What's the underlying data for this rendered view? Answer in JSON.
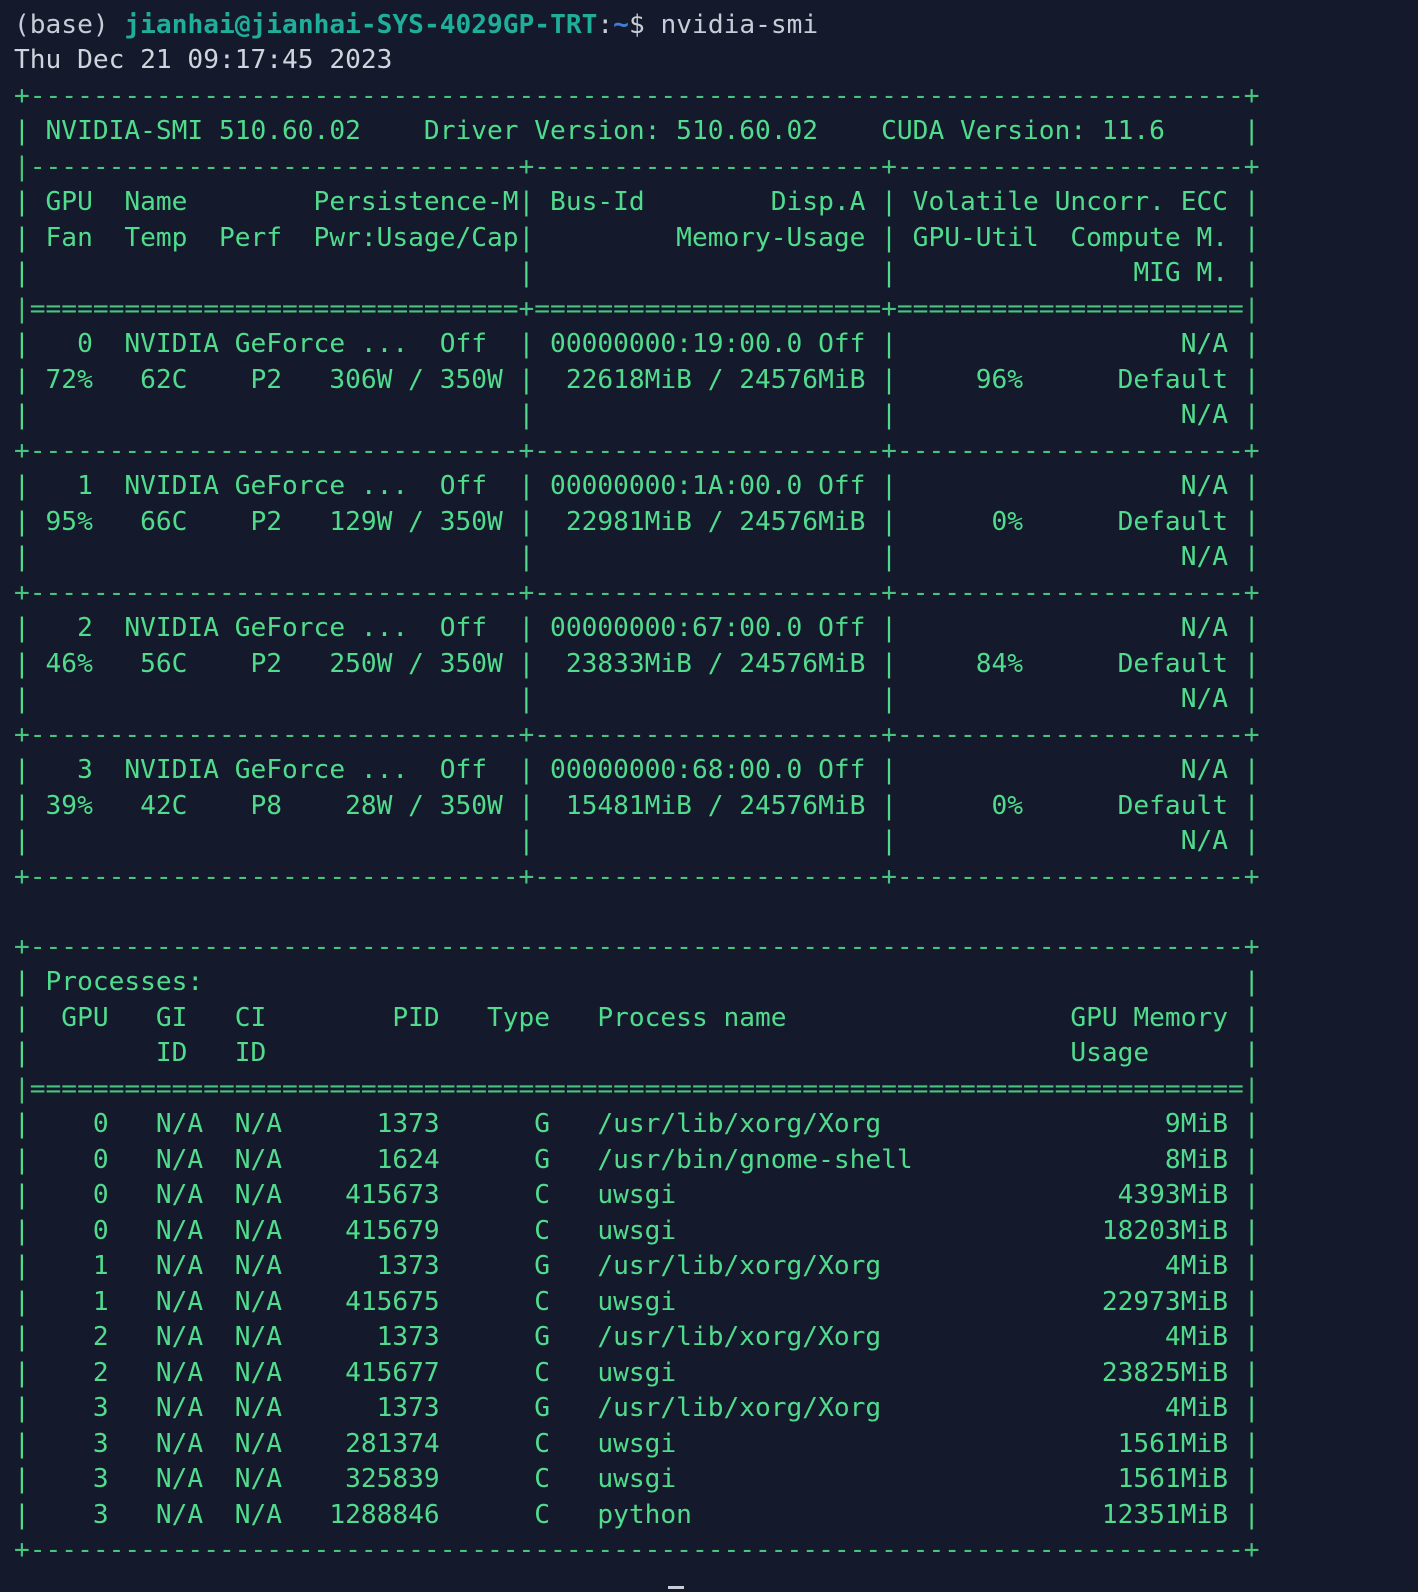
{
  "prompt": {
    "env": "(base)",
    "user_host": "jianhai@jianhai-SYS-4029GP-TRT",
    "colon": ":",
    "path": "~",
    "dollar": "$",
    "command": "nvidia-smi"
  },
  "timestamp": "Thu Dec 21 09:17:45 2023",
  "gpu_table": {
    "border_top": "+-----------------------------------------------------------------------------+",
    "version_line": "| NVIDIA-SMI 510.60.02    Driver Version: 510.60.02    CUDA Version: 11.6     |",
    "header_separator": "|-------------------------------+----------------------+----------------------+",
    "header_row_1": "| GPU  Name        Persistence-M| Bus-Id        Disp.A | Volatile Uncorr. ECC |",
    "header_row_2": "| Fan  Temp  Perf  Pwr:Usage/Cap|         Memory-Usage | GPU-Util  Compute M. |",
    "header_row_3": "|                               |                      |               MIG M. |",
    "header_double_rule": "|===============================+======================+======================|",
    "row_separator": "+-------------------------------+----------------------+----------------------+",
    "gpus": [
      {
        "line1": "|   0  NVIDIA GeForce ...  Off  | 00000000:19:00.0 Off |                  N/A |",
        "line2": "| 72%   62C    P2   306W / 350W |  22618MiB / 24576MiB |     96%      Default |",
        "line3": "|                               |                      |                  N/A |"
      },
      {
        "line1": "|   1  NVIDIA GeForce ...  Off  | 00000000:1A:00.0 Off |                  N/A |",
        "line2": "| 95%   66C    P2   129W / 350W |  22981MiB / 24576MiB |      0%      Default |",
        "line3": "|                               |                      |                  N/A |"
      },
      {
        "line1": "|   2  NVIDIA GeForce ...  Off  | 00000000:67:00.0 Off |                  N/A |",
        "line2": "| 46%   56C    P2   250W / 350W |  23833MiB / 24576MiB |     84%      Default |",
        "line3": "|                               |                      |                  N/A |"
      },
      {
        "line1": "|   3  NVIDIA GeForce ...  Off  | 00000000:68:00.0 Off |                  N/A |",
        "line2": "| 39%   42C    P8    28W / 350W |  15481MiB / 24576MiB |      0%      Default |",
        "line3": "|                               |                      |                  N/A |"
      }
    ]
  },
  "process_table": {
    "border_top": "+-----------------------------------------------------------------------------+",
    "title_line": "| Processes:                                                                  |",
    "header_row_1": "|  GPU   GI   CI        PID   Type   Process name                  GPU Memory |",
    "header_row_2": "|        ID   ID                                                   Usage      |",
    "double_rule": "|=============================================================================|",
    "rows": [
      "|    0   N/A  N/A      1373      G   /usr/lib/xorg/Xorg                  9MiB |",
      "|    0   N/A  N/A      1624      G   /usr/bin/gnome-shell                8MiB |",
      "|    0   N/A  N/A    415673      C   uwsgi                            4393MiB |",
      "|    0   N/A  N/A    415679      C   uwsgi                           18203MiB |",
      "|    1   N/A  N/A      1373      G   /usr/lib/xorg/Xorg                  4MiB |",
      "|    1   N/A  N/A    415675      C   uwsgi                           22973MiB |",
      "|    2   N/A  N/A      1373      G   /usr/lib/xorg/Xorg                  4MiB |",
      "|    2   N/A  N/A    415677      C   uwsgi                           23825MiB |",
      "|    3   N/A  N/A      1373      G   /usr/lib/xorg/Xorg                  4MiB |",
      "|    3   N/A  N/A    281374      C   uwsgi                            1561MiB |",
      "|    3   N/A  N/A    325839      C   uwsgi                            1561MiB |",
      "|    3   N/A  N/A   1288846      C   python                          12351MiB |"
    ],
    "border_bottom": "+-----------------------------------------------------------------------------+"
  },
  "colors": {
    "background": "#141a2c",
    "table_text": "#50dc8c",
    "user_host": "#1fae9a",
    "path": "#3f7fd8",
    "plain_text": "#c8ccd6"
  }
}
